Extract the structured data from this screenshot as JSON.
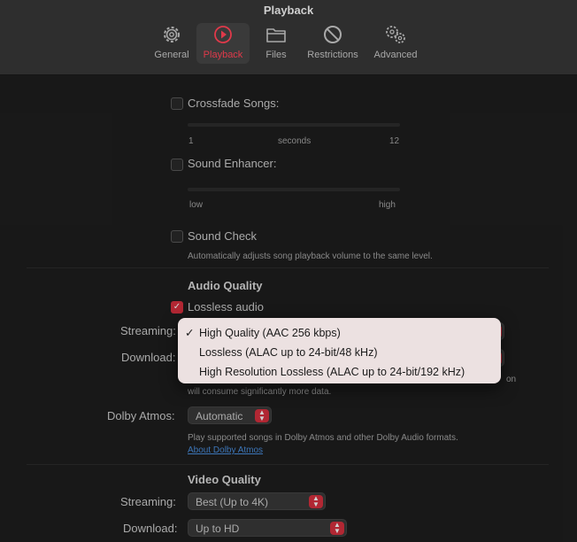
{
  "window": {
    "title": "Playback"
  },
  "toolbar": {
    "tabs": [
      {
        "label": "General",
        "icon": "gear-icon"
      },
      {
        "label": "Playback",
        "icon": "play-circle-icon",
        "active": true
      },
      {
        "label": "Files",
        "icon": "folder-icon"
      },
      {
        "label": "Restrictions",
        "icon": "prohibited-icon"
      },
      {
        "label": "Advanced",
        "icon": "gears-icon"
      }
    ]
  },
  "crossfade": {
    "label": "Crossfade Songs:",
    "min": "1",
    "unit": "seconds",
    "max": "12",
    "checked": false
  },
  "enhancer": {
    "label": "Sound Enhancer:",
    "min": "low",
    "max": "high",
    "checked": false
  },
  "sound_check": {
    "label": "Sound Check",
    "description": "Automatically adjusts song playback volume to the same level.",
    "checked": false
  },
  "audio_quality": {
    "header": "Audio Quality",
    "lossless_label": "Lossless audio",
    "lossless_checked": true,
    "streaming_label": "Streaming:",
    "download_label": "Download:",
    "note_tail_1": "on",
    "note_line_2": "will consume significantly more data.",
    "dolby_label": "Dolby Atmos:",
    "dolby_value": "Automatic",
    "dolby_description": "Play supported songs in Dolby Atmos and other Dolby Audio formats.",
    "dolby_link": "About Dolby Atmos"
  },
  "quality_menu": {
    "check": "✓",
    "items": [
      "High Quality (AAC 256 kbps)",
      "Lossless (ALAC up to 24-bit/48 kHz)",
      "High Resolution Lossless (ALAC up to 24-bit/192 kHz)"
    ]
  },
  "video_quality": {
    "header": "Video Quality",
    "streaming_label": "Streaming:",
    "streaming_value": "Best (Up to 4K)",
    "download_label": "Download:",
    "download_value": "Up to HD"
  },
  "colors": {
    "accent": "#d8303f",
    "background": "#1e1e1e",
    "menu_bg": "#ece1e1",
    "link": "#4a8fe0"
  }
}
